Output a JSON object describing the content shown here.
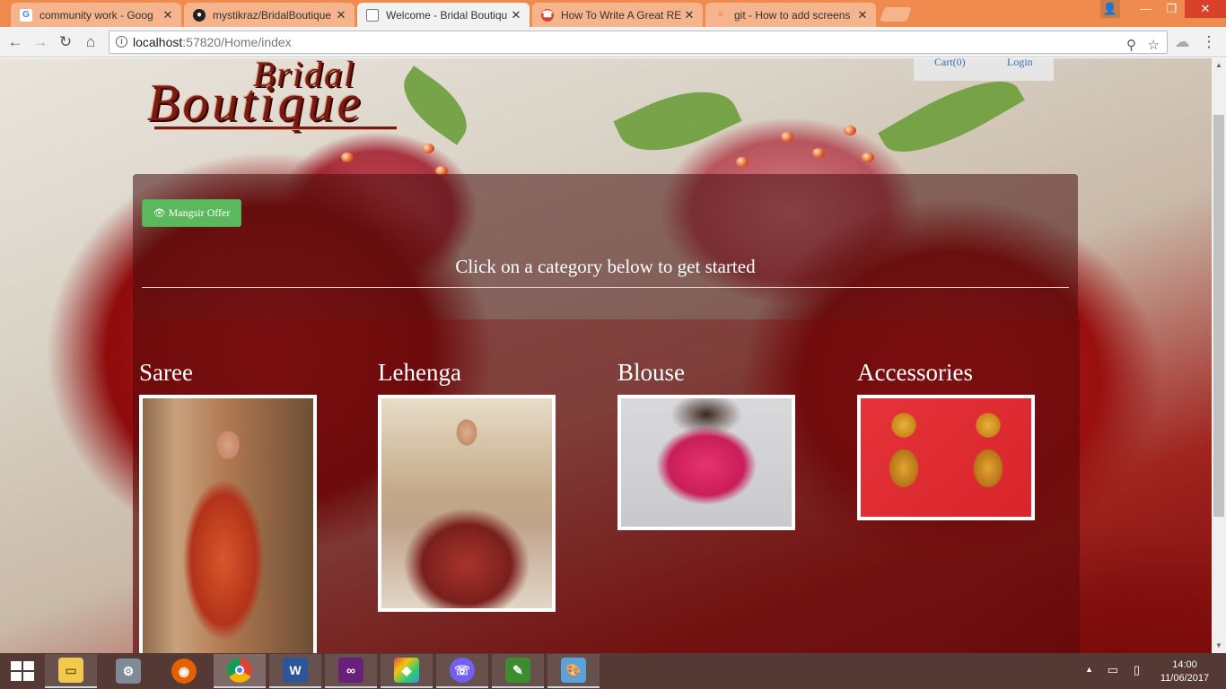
{
  "browser": {
    "tabs": [
      {
        "title": "community work - Goog",
        "favicon": "google-icon",
        "active": false
      },
      {
        "title": "mystikraz/BridalBoutique",
        "favicon": "github-icon",
        "active": false
      },
      {
        "title": "Welcome - Bridal Boutiqu",
        "favicon": "page-icon",
        "active": true
      },
      {
        "title": "How To Write A Great RE",
        "favicon": "phone-icon",
        "active": false
      },
      {
        "title": "git - How to add screens",
        "favicon": "stackoverflow-icon",
        "active": false
      }
    ],
    "tab_close_glyph": "✕",
    "url_host": "localhost",
    "url_rest": ":57820/Home/index"
  },
  "page": {
    "logo_line1": "Bridal",
    "logo_line2": "Boutique",
    "nav": {
      "cart": "Cart(0)",
      "login": "Login"
    },
    "offer_button": "Mangsir Offer",
    "headline": "Click on a category below to get started",
    "categories": [
      {
        "name": "Saree"
      },
      {
        "name": "Lehenga"
      },
      {
        "name": "Blouse"
      },
      {
        "name": "Accessories"
      }
    ]
  },
  "taskbar": {
    "time": "14:00",
    "date": "11/06/2017"
  },
  "colors": {
    "offer_button": "#5cb85c",
    "link": "#3a6fb0",
    "tabstrip": "#f08b4f"
  }
}
